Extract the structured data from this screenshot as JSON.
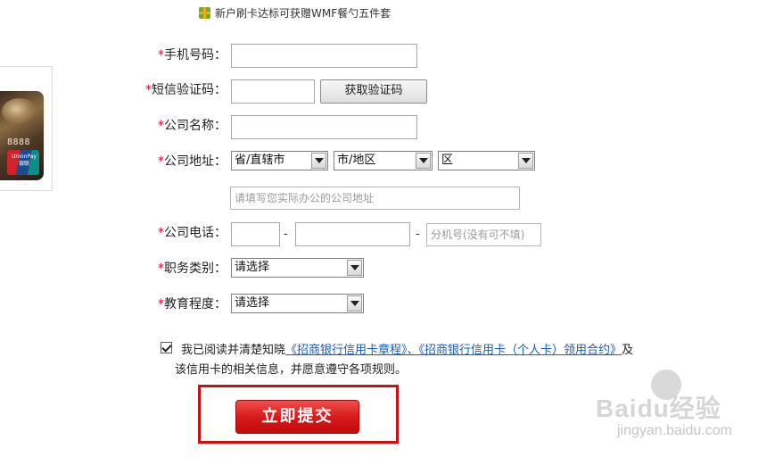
{
  "promo": {
    "text": "新户刷卡达标可获赠WMF餐勺五件套",
    "icon": "gift-icon"
  },
  "card": {
    "number": "8888",
    "network_text": "UnionPay 银联"
  },
  "form": {
    "required_mark": "*",
    "mobile": {
      "label": "手机号码：",
      "value": ""
    },
    "sms_code": {
      "label": "短信验证码：",
      "value": "",
      "button": "获取验证码"
    },
    "company_name": {
      "label": "公司名称：",
      "value": ""
    },
    "company_address": {
      "label": "公司地址：",
      "province": "省/直辖市",
      "city": "市/地区",
      "district": "区",
      "detail_placeholder": "请填写您实际办公的公司地址"
    },
    "company_phone": {
      "label": "公司电话：",
      "separator": "-",
      "extension_placeholder": "分机号(没有可不填)"
    },
    "job_category": {
      "label": "职务类别：",
      "selected": "请选择"
    },
    "education": {
      "label": "教育程度：",
      "selected": "请选择"
    }
  },
  "agreement": {
    "checked": true,
    "prefix": "我已阅读并清楚知晓",
    "link": "《招商银行信用卡章程》、《招商银行信用卡（个人卡）领用合约》",
    "suffix": "及",
    "line2": "该信用卡的相关信息，并愿意遵守各项规则。"
  },
  "submit": {
    "label": "立即提交"
  },
  "watermark": {
    "main": "Baidu经验",
    "sub": "jingyan.baidu.com"
  },
  "colors": {
    "required": "#c8102e",
    "submit": "#d81a1a",
    "highlight_box": "#cc1010",
    "link": "#1a5fb4"
  }
}
